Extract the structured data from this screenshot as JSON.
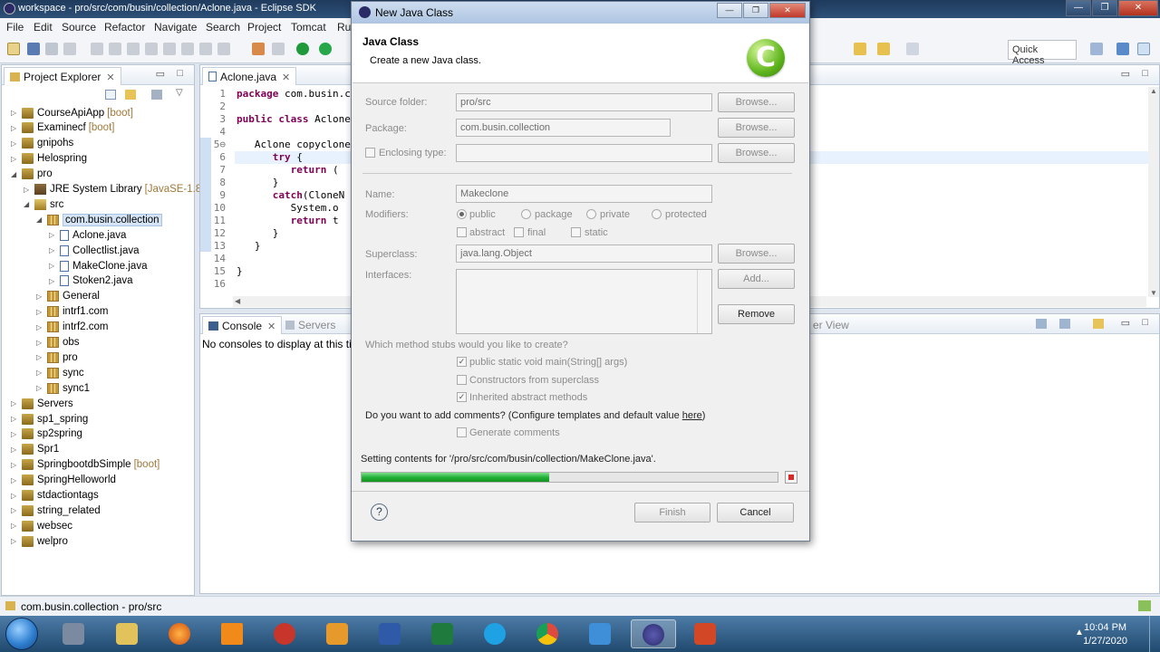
{
  "window": {
    "title": "workspace - pro/src/com/busin/collection/Aclone.java - Eclipse SDK"
  },
  "menu": [
    "File",
    "Edit",
    "Source",
    "Refactor",
    "Navigate",
    "Search",
    "Project",
    "Tomcat",
    "Ru"
  ],
  "toolbar": {
    "quick_access": "Quick Access"
  },
  "project_explorer": {
    "tab": "Project Explorer",
    "items": [
      {
        "label": "CourseApiApp",
        "tag": "[boot]",
        "depth": 0,
        "arrow": "▷",
        "icon": "project-icon"
      },
      {
        "label": "Examinecf",
        "tag": "[boot]",
        "depth": 0,
        "arrow": "▷",
        "icon": "project-icon"
      },
      {
        "label": "gnipohs",
        "tag": "",
        "depth": 0,
        "arrow": "▷",
        "icon": "project-icon"
      },
      {
        "label": "Helospring",
        "tag": "",
        "depth": 0,
        "arrow": "▷",
        "icon": "project-icon"
      },
      {
        "label": "pro",
        "tag": "",
        "depth": 0,
        "arrow": "◢",
        "icon": "project-icon"
      },
      {
        "label": "JRE System Library",
        "tag": "[JavaSE-1.8]",
        "depth": 1,
        "arrow": "▷",
        "icon": "library-icon"
      },
      {
        "label": "src",
        "tag": "",
        "depth": 1,
        "arrow": "◢",
        "icon": "source-folder-icon"
      },
      {
        "label": "com.busin.collection",
        "tag": "",
        "depth": 2,
        "arrow": "◢",
        "icon": "package-icon",
        "selected": true
      },
      {
        "label": "Aclone.java",
        "tag": "",
        "depth": 3,
        "arrow": "▷",
        "icon": "java-file-icon"
      },
      {
        "label": "Collectlist.java",
        "tag": "",
        "depth": 3,
        "arrow": "▷",
        "icon": "java-file-icon"
      },
      {
        "label": "MakeClone.java",
        "tag": "",
        "depth": 3,
        "arrow": "▷",
        "icon": "java-file-icon"
      },
      {
        "label": "Stoken2.java",
        "tag": "",
        "depth": 3,
        "arrow": "▷",
        "icon": "java-file-icon"
      },
      {
        "label": "General",
        "tag": "",
        "depth": 2,
        "arrow": "▷",
        "icon": "package-icon"
      },
      {
        "label": "intrf1.com",
        "tag": "",
        "depth": 2,
        "arrow": "▷",
        "icon": "package-icon"
      },
      {
        "label": "intrf2.com",
        "tag": "",
        "depth": 2,
        "arrow": "▷",
        "icon": "package-icon"
      },
      {
        "label": "obs",
        "tag": "",
        "depth": 2,
        "arrow": "▷",
        "icon": "package-icon"
      },
      {
        "label": "pro",
        "tag": "",
        "depth": 2,
        "arrow": "▷",
        "icon": "package-icon"
      },
      {
        "label": "sync",
        "tag": "",
        "depth": 2,
        "arrow": "▷",
        "icon": "package-icon"
      },
      {
        "label": "sync1",
        "tag": "",
        "depth": 2,
        "arrow": "▷",
        "icon": "package-icon"
      },
      {
        "label": "Servers",
        "tag": "",
        "depth": 0,
        "arrow": "▷",
        "icon": "project-icon"
      },
      {
        "label": "sp1_spring",
        "tag": "",
        "depth": 0,
        "arrow": "▷",
        "icon": "project-icon"
      },
      {
        "label": "sp2spring",
        "tag": "",
        "depth": 0,
        "arrow": "▷",
        "icon": "project-icon"
      },
      {
        "label": "Spr1",
        "tag": "",
        "depth": 0,
        "arrow": "▷",
        "icon": "project-icon"
      },
      {
        "label": "SpringbootdbSimple",
        "tag": "[boot]",
        "depth": 0,
        "arrow": "▷",
        "icon": "project-icon"
      },
      {
        "label": "SpringHelloworld",
        "tag": "",
        "depth": 0,
        "arrow": "▷",
        "icon": "project-icon"
      },
      {
        "label": "stdactiontags",
        "tag": "",
        "depth": 0,
        "arrow": "▷",
        "icon": "project-icon"
      },
      {
        "label": "string_related",
        "tag": "",
        "depth": 0,
        "arrow": "▷",
        "icon": "project-icon"
      },
      {
        "label": "websec",
        "tag": "",
        "depth": 0,
        "arrow": "▷",
        "icon": "project-icon"
      },
      {
        "label": "welpro",
        "tag": "",
        "depth": 0,
        "arrow": "▷",
        "icon": "project-icon"
      }
    ]
  },
  "editor": {
    "tab": "Aclone.java",
    "lines": [
      {
        "n": "1",
        "text": "package com.busin.co"
      },
      {
        "n": "2",
        "text": ""
      },
      {
        "n": "3",
        "text": "public class Aclone"
      },
      {
        "n": "4",
        "text": ""
      },
      {
        "n": "5⊖",
        "text": "   Aclone copyclone"
      },
      {
        "n": "6",
        "text": "      try {"
      },
      {
        "n": "7",
        "text": "         return ("
      },
      {
        "n": "8",
        "text": "      }"
      },
      {
        "n": "9",
        "text": "      catch(CloneN"
      },
      {
        "n": "10",
        "text": "         System.o"
      },
      {
        "n": "11",
        "text": "         return t"
      },
      {
        "n": "12",
        "text": "      }"
      },
      {
        "n": "13",
        "text": "   }"
      },
      {
        "n": "14",
        "text": ""
      },
      {
        "n": "15",
        "text": "}"
      },
      {
        "n": "16",
        "text": ""
      }
    ]
  },
  "console": {
    "tab": "Console",
    "tab2": "Servers",
    "message": "No consoles to display at this tim",
    "right_tab_fragment": "er View"
  },
  "status_bar": {
    "text": "com.busin.collection - pro/src"
  },
  "dialog": {
    "title": "New Java Class",
    "heading": "Java Class",
    "subheading": "Create a new Java class.",
    "source_folder_label": "Source folder:",
    "source_folder_value": "pro/src",
    "package_label": "Package:",
    "package_value": "com.busin.collection",
    "enclosing_type_label": "Enclosing type:",
    "name_label": "Name:",
    "name_value": "Makeclone",
    "modifiers_label": "Modifiers:",
    "modifier_public": "public",
    "modifier_package": "package",
    "modifier_private": "private",
    "modifier_protected": "protected",
    "modifier_abstract": "abstract",
    "modifier_final": "final",
    "modifier_static": "static",
    "superclass_label": "Superclass:",
    "superclass_value": "java.lang.Object",
    "interfaces_label": "Interfaces:",
    "browse": "Browse...",
    "add": "Add...",
    "remove": "Remove",
    "stubs_question": "Which method stubs would you like to create?",
    "stub_main": "public static void main(String[] args)",
    "stub_constructors": "Constructors from superclass",
    "stub_inherited": "Inherited abstract methods",
    "comments_question_pre": "Do you want to add comments? (Configure templates and default value ",
    "comments_link": "here",
    "comments_question_post": ")",
    "generate_comments": "Generate comments",
    "progress_text": "Setting contents for '/pro/src/com/busin/collection/MakeClone.java'.",
    "progress_fraction": 0.45,
    "help": "?",
    "finish": "Finish",
    "cancel": "Cancel"
  },
  "taskbar": {
    "time": "10:04 PM",
    "date": "1/27/2020"
  }
}
